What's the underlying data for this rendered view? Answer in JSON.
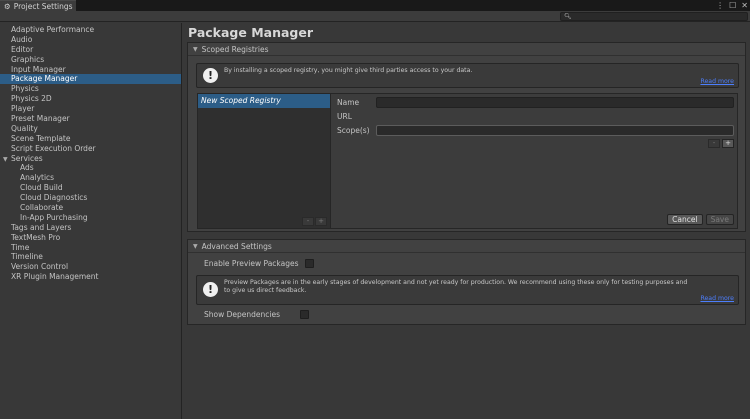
{
  "window": {
    "tab_title": "Project Settings"
  },
  "sidebar": {
    "items": [
      {
        "label": "Adaptive Performance",
        "level": 0
      },
      {
        "label": "Audio",
        "level": 0
      },
      {
        "label": "Editor",
        "level": 0
      },
      {
        "label": "Graphics",
        "level": 0
      },
      {
        "label": "Input Manager",
        "level": 0
      },
      {
        "label": "Package Manager",
        "level": 0,
        "selected": true
      },
      {
        "label": "Physics",
        "level": 0
      },
      {
        "label": "Physics 2D",
        "level": 0
      },
      {
        "label": "Player",
        "level": 0
      },
      {
        "label": "Preset Manager",
        "level": 0
      },
      {
        "label": "Quality",
        "level": 0
      },
      {
        "label": "Scene Template",
        "level": 0
      },
      {
        "label": "Script Execution Order",
        "level": 0
      },
      {
        "label": "Services",
        "level": 0,
        "expanded": true
      },
      {
        "label": "Ads",
        "level": 1
      },
      {
        "label": "Analytics",
        "level": 1
      },
      {
        "label": "Cloud Build",
        "level": 1
      },
      {
        "label": "Cloud Diagnostics",
        "level": 1
      },
      {
        "label": "Collaborate",
        "level": 1
      },
      {
        "label": "In-App Purchasing",
        "level": 1
      },
      {
        "label": "Tags and Layers",
        "level": 0
      },
      {
        "label": "TextMesh Pro",
        "level": 0
      },
      {
        "label": "Time",
        "level": 0
      },
      {
        "label": "Timeline",
        "level": 0
      },
      {
        "label": "Version Control",
        "level": 0
      },
      {
        "label": "XR Plugin Management",
        "level": 0
      }
    ]
  },
  "main": {
    "title": "Package Manager",
    "scoped": {
      "header": "Scoped Registries",
      "help_text": "By installing a scoped registry, you might give third parties access to your data.",
      "read_more": "Read more",
      "registry_item": "New Scoped Registry",
      "name_label": "Name",
      "url_label": "URL",
      "scopes_label": "Scope(s)",
      "minus": "-",
      "plus": "+",
      "cancel_label": "Cancel",
      "save_label": "Save"
    },
    "advanced": {
      "header": "Advanced Settings",
      "enable_preview_label": "Enable Preview Packages",
      "help_text": "Preview Packages are in the early stages of development and not yet ready for production. We recommend using these only for testing purposes and to give us direct feedback.",
      "read_more": "Read more",
      "show_deps_label": "Show Dependencies"
    }
  }
}
